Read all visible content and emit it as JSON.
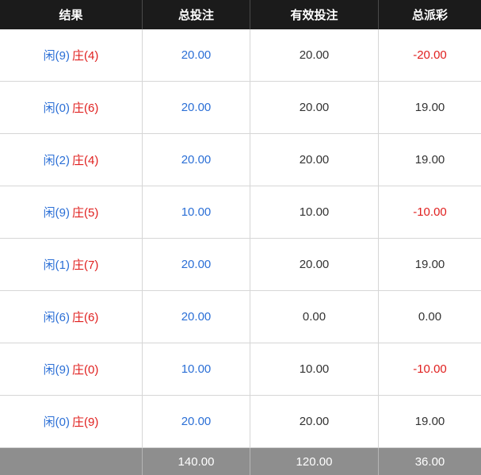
{
  "header": {
    "result": "结果",
    "total_bet": "总投注",
    "valid_bet": "有效投注",
    "total_payout": "总派彩"
  },
  "rows": [
    {
      "player": "闲(9)",
      "banker": "庄(4)",
      "total_bet": "20.00",
      "valid_bet": "20.00",
      "payout": "-20.00",
      "payout_color": "red"
    },
    {
      "player": "闲(0)",
      "banker": "庄(6)",
      "total_bet": "20.00",
      "valid_bet": "20.00",
      "payout": "19.00",
      "payout_color": "dark"
    },
    {
      "player": "闲(2)",
      "banker": "庄(4)",
      "total_bet": "20.00",
      "valid_bet": "20.00",
      "payout": "19.00",
      "payout_color": "dark"
    },
    {
      "player": "闲(9)",
      "banker": "庄(5)",
      "total_bet": "10.00",
      "valid_bet": "10.00",
      "payout": "-10.00",
      "payout_color": "red"
    },
    {
      "player": "闲(1)",
      "banker": "庄(7)",
      "total_bet": "20.00",
      "valid_bet": "20.00",
      "payout": "19.00",
      "payout_color": "dark"
    },
    {
      "player": "闲(6)",
      "banker": "庄(6)",
      "total_bet": "20.00",
      "valid_bet": "0.00",
      "payout": "0.00",
      "payout_color": "dark"
    },
    {
      "player": "闲(9)",
      "banker": "庄(0)",
      "total_bet": "10.00",
      "valid_bet": "10.00",
      "payout": "-10.00",
      "payout_color": "red"
    },
    {
      "player": "闲(0)",
      "banker": "庄(9)",
      "total_bet": "20.00",
      "valid_bet": "20.00",
      "payout": "19.00",
      "payout_color": "dark"
    }
  ],
  "footer": {
    "total_bet": "140.00",
    "valid_bet": "120.00",
    "total_payout": "36.00"
  },
  "colors": {
    "player": "#2b6fd6",
    "banker": "#e0201f",
    "header_bg": "#1b1b1b",
    "footer_bg": "#8e8e8e"
  }
}
